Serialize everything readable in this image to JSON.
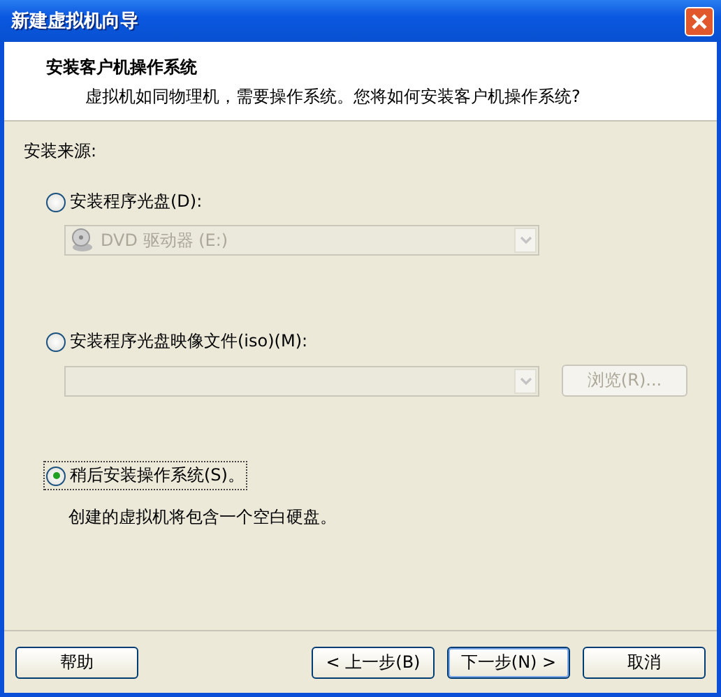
{
  "window": {
    "title": "新建虚拟机向导"
  },
  "header": {
    "title": "安装客户机操作系统",
    "subtitle": "虚拟机如同物理机，需要操作系统。您将如何安装客户机操作系统?"
  },
  "section_label": "安装来源:",
  "options": [
    {
      "kind": "disc",
      "label": "安装程序光盘(D):",
      "selected": false,
      "dropdown": {
        "value": "DVD 驱动器 (E:)",
        "disabled": true
      }
    },
    {
      "kind": "image",
      "label": "安装程序光盘映像文件(iso)(M):",
      "selected": false,
      "dropdown": {
        "disabled": true
      },
      "browse": {
        "label": "浏览(R)...",
        "disabled": true
      }
    },
    {
      "kind": "later",
      "label": "稍后安装操作系统(S)。",
      "selected": true,
      "description": "创建的虚拟机将包含一个空白硬盘。"
    }
  ],
  "buttons": [
    {
      "label": "帮助",
      "default": false
    },
    {
      "label": "< 上一步(B)",
      "default": false
    },
    {
      "label": "下一步(N) >",
      "default": true
    },
    {
      "label": "取消",
      "default": false
    }
  ]
}
